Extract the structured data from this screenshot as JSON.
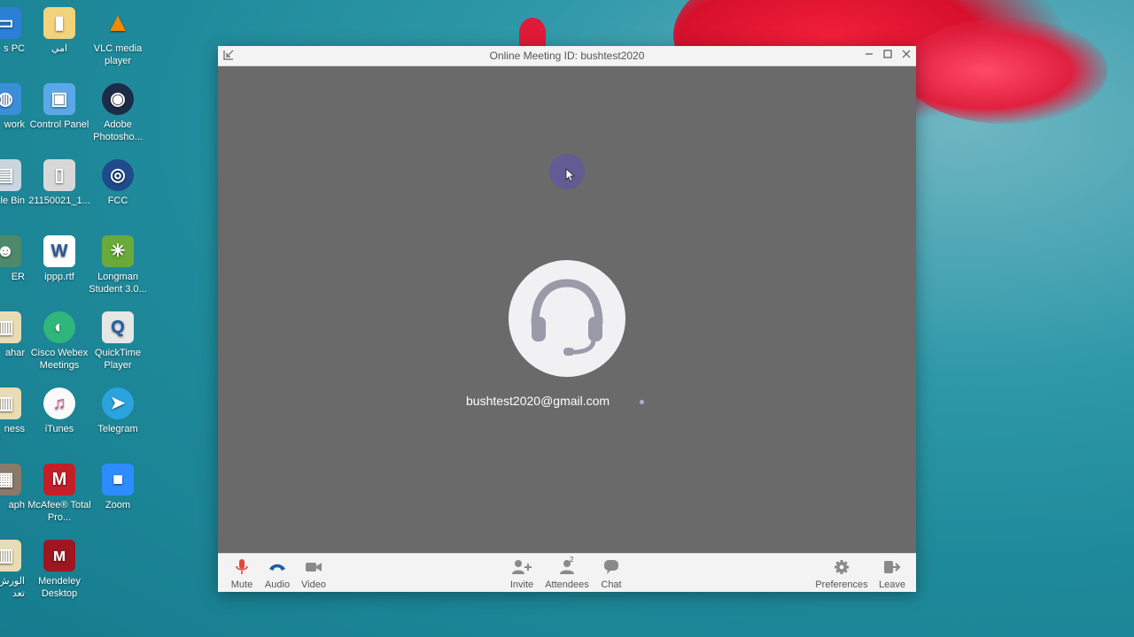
{
  "desktop": {
    "icons": [
      {
        "label": "s PC"
      },
      {
        "label": "امي"
      },
      {
        "label": "VLC media player"
      },
      {
        "label": "work"
      },
      {
        "label": "Control Panel"
      },
      {
        "label": "Adobe Photosho..."
      },
      {
        "label": "le Bin"
      },
      {
        "label": "21150021_1..."
      },
      {
        "label": "FCC"
      },
      {
        "label": "ER"
      },
      {
        "label": "ippp.rtf"
      },
      {
        "label": "Longman Student 3.0..."
      },
      {
        "label": "ahar"
      },
      {
        "label": "Cisco Webex Meetings"
      },
      {
        "label": "QuickTime Player"
      },
      {
        "label": "ness"
      },
      {
        "label": "iTunes"
      },
      {
        "label": "Telegram"
      },
      {
        "label": "aph"
      },
      {
        "label": "McAfee® Total Pro..."
      },
      {
        "label": "Zoom"
      },
      {
        "label": "الورش تعد"
      },
      {
        "label": "Mendeley Desktop"
      }
    ]
  },
  "window": {
    "title": "Online Meeting ID: bushtest2020",
    "participant_email": "bushtest2020@gmail.com",
    "attendee_count": "2",
    "toolbar": {
      "mute": "Mute",
      "audio": "Audio",
      "video": "Video",
      "invite": "Invite",
      "attendees": "Attendees",
      "chat": "Chat",
      "preferences": "Preferences",
      "leave": "Leave"
    }
  },
  "colors": {
    "mute_icon": "#e0483a",
    "audio_icon": "#1e5fa6",
    "toolbar_icon": "#8a8a8a",
    "stage_bg": "#6a6a6a",
    "avatar_bg": "#f1f1f4",
    "headset": "#9a9aa8"
  },
  "icons": {
    "restore": "restore-down-icon",
    "minimize": "minimize-icon",
    "maximize": "maximize-icon",
    "close": "close-icon"
  }
}
